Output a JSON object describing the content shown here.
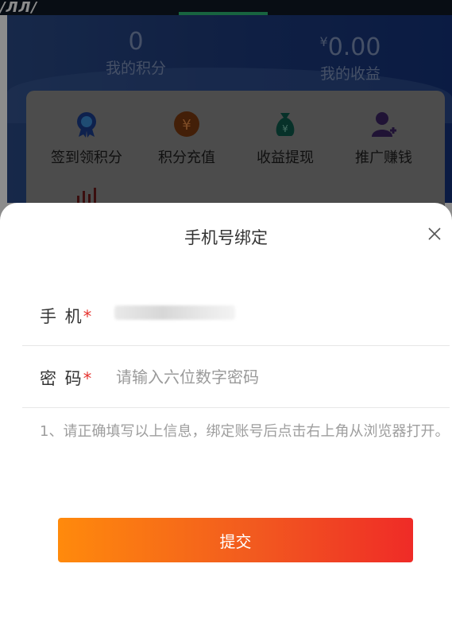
{
  "header": {
    "logo_text": "/ЛЛ/"
  },
  "stats": {
    "points": {
      "value": "0",
      "label": "我的积分"
    },
    "earnings": {
      "currency": "¥",
      "value": "0.00",
      "label": "我的收益"
    }
  },
  "menu": {
    "items": [
      {
        "label": "签到领积分",
        "icon": "badge-icon"
      },
      {
        "label": "积分充值",
        "icon": "yen-coin-icon"
      },
      {
        "label": "收益提现",
        "icon": "money-bag-icon"
      },
      {
        "label": "推广赚钱",
        "icon": "add-user-icon"
      },
      {
        "label": "",
        "icon": "bar-chart-icon"
      }
    ]
  },
  "dialog": {
    "title": "手机号绑定",
    "close_icon": "close-icon",
    "phone": {
      "label": "手 机",
      "required_mark": "*",
      "value": ""
    },
    "password": {
      "label": "密 码",
      "required_mark": "*",
      "placeholder": "请输入六位数字密码"
    },
    "tip": "1、请正确填写以上信息，绑定账号后点击右上角从浏览器打开。",
    "submit_label": "提交"
  },
  "colors": {
    "accent_green": "#2db776",
    "button_gradient_start": "#ff8a0c",
    "button_gradient_end": "#ef2b27",
    "required": "#e5332f"
  }
}
